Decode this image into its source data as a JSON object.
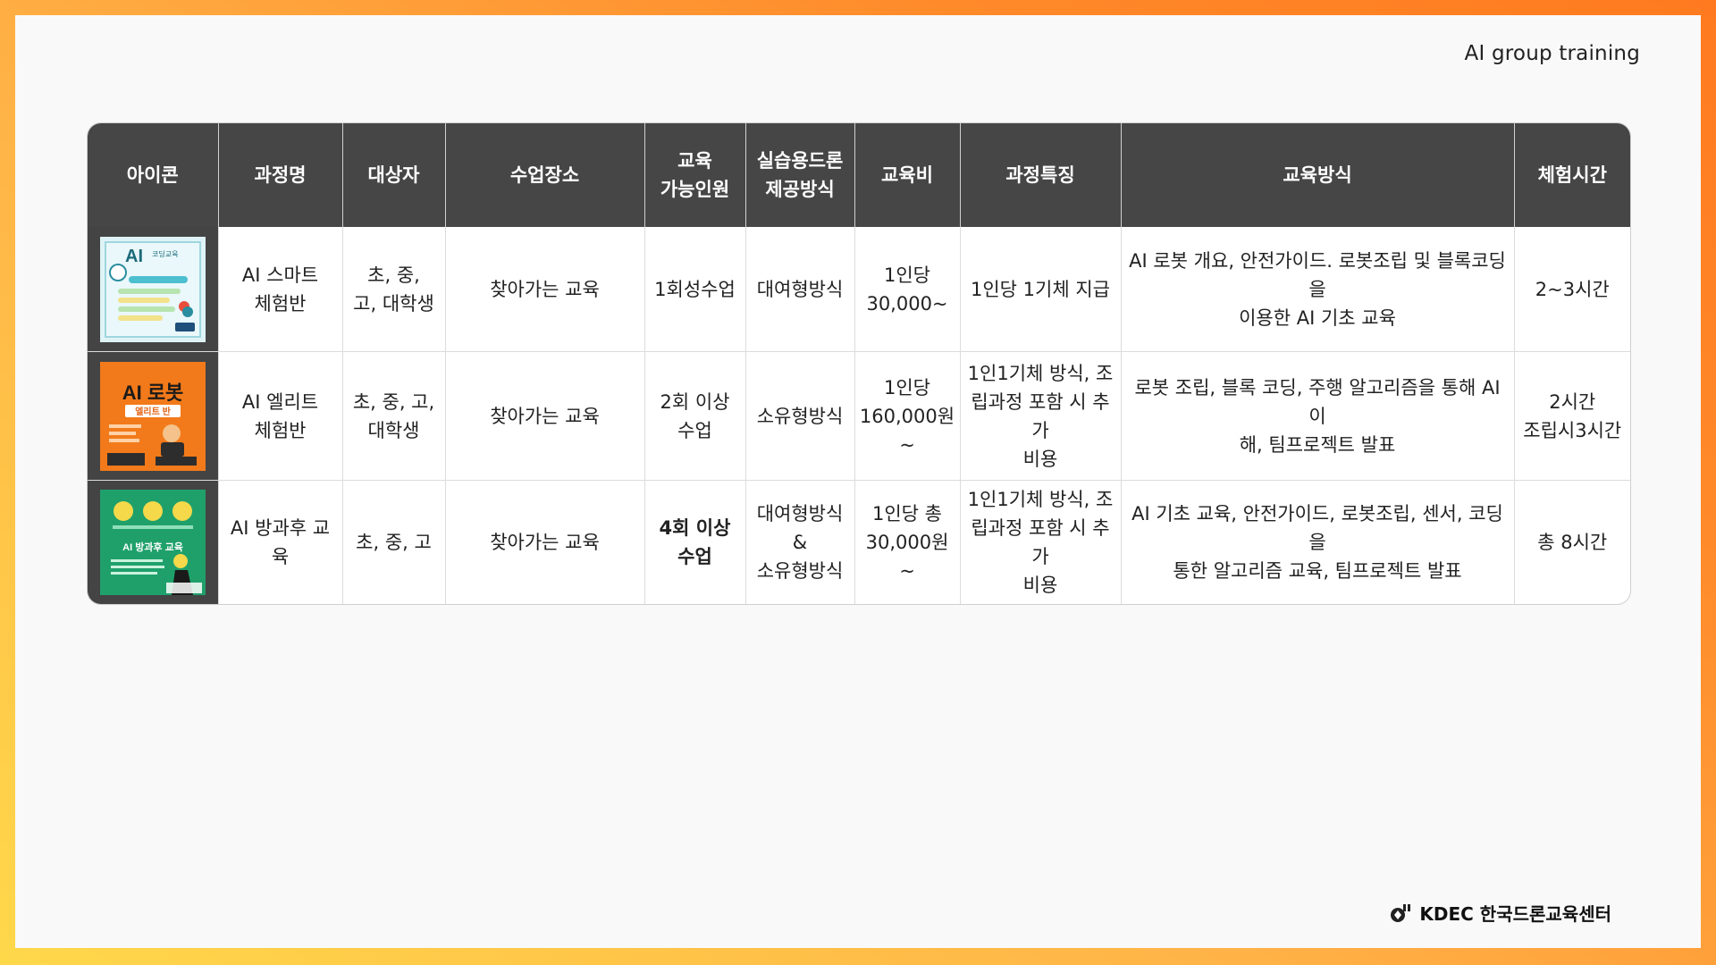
{
  "header": {
    "label": "AI group training"
  },
  "table": {
    "columns": [
      "아이콘",
      "과정명",
      "대상자",
      "수업장소",
      "교육\n가능인원",
      "실습용드론\n제공방식",
      "교육비",
      "과정특징",
      "교육방식",
      "체험시간"
    ],
    "rows": [
      {
        "icon": "ai-smart-course-thumbnail",
        "name": "AI 스마트\n체험반",
        "target": "초, 중,\n고, 대학생",
        "place": "찾아가는 교육",
        "capacity": "1회성수업",
        "drone": "대여형방식",
        "fee": "1인당\n30,000~",
        "feature": "1인당 1기체 지급",
        "method": "AI 로봇 개요, 안전가이드. 로봇조립 및 블록코딩을\n이용한 AI 기초 교육",
        "time": "2~3시간",
        "thumb_title": "AI",
        "thumb_subtitle": "코딩교육"
      },
      {
        "icon": "ai-robot-elite-thumbnail",
        "name": "AI 엘리트\n체험반",
        "target": "초, 중, 고,\n대학생",
        "place": "찾아가는 교육",
        "capacity": "2회 이상\n수업",
        "drone": "소유형방식",
        "fee": "1인당\n160,000원\n~",
        "feature": "1인1기체 방식, 조\n립과정 포함 시 추가\n비용",
        "method": "로봇 조립, 블록 코딩, 주행 알고리즘을 통해 AI 이\n해, 팀프로젝트 발표",
        "time": "2시간\n조립시3시간",
        "thumb_title": "AI 로봇",
        "thumb_subtitle": "엘리트 반"
      },
      {
        "icon": "ai-afterschool-thumbnail",
        "name": "AI 방과후 교육",
        "target": "초, 중, 고",
        "place": "찾아가는 교육",
        "capacity": "4회 이상\n수업",
        "drone": "대여형방식\n&\n소유형방식",
        "fee": "1인당 총\n30,000원~",
        "feature": "1인1기체 방식, 조\n립과정 포함 시 추가\n비용",
        "method": "AI 기초 교육, 안전가이드, 로봇조립, 센서, 코딩을\n통한 알고리즘 교육, 팀프로젝트 발표",
        "time": "총 8시간",
        "thumb_title": "AI 방과후 교육",
        "thumb_subtitle": ""
      }
    ]
  },
  "footer": {
    "brand": "KDEC 한국드론교육센터"
  },
  "colors": {
    "header_bg": "#464646",
    "frame_start": "#ffd84a",
    "frame_end": "#ff7a1f"
  }
}
